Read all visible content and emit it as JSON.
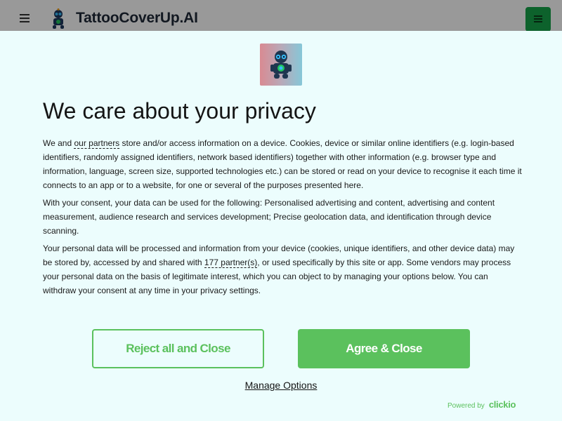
{
  "site": {
    "title": "TattooCoverUp.AI"
  },
  "dialog": {
    "title": "We care about your privacy",
    "p1": {
      "pre": "We and ",
      "link": "our partners",
      "post": " store and/or access information on a device. Cookies, device or similar online identifiers (e.g. login-based identifiers, randomly assigned identifiers, network based identifiers) together with other information (e.g. browser type and information, language, screen size, supported technologies etc.) can be stored or read on your device to recognise it each time it connects to an app or to a website, for one or several of the purposes presented here."
    },
    "p2": "With your consent, your data can be used for the following: Personalised advertising and content, advertising and content measurement, audience research and services development; Precise geolocation data, and identification through device scanning.",
    "p3": {
      "pre": "Your personal data will be processed and information from your device (cookies, unique identifiers, and other device data) may be stored by, accessed by and shared with ",
      "link": "177 partner(s)",
      "post": ", or used specifically by this site or app. Some vendors may process your personal data on the basis of legitimate interest, which you can object to by managing your options below. You can withdraw your consent at any time in your privacy settings."
    },
    "reject_label": "Reject all and Close",
    "agree_label": "Agree & Close",
    "manage_label": "Manage Options",
    "powered_by": "Powered by",
    "brand": "clickio"
  },
  "colors": {
    "accent": "#5bc15d",
    "dialog_bg": "#ecfdfd",
    "header_button": "#16a34a"
  }
}
